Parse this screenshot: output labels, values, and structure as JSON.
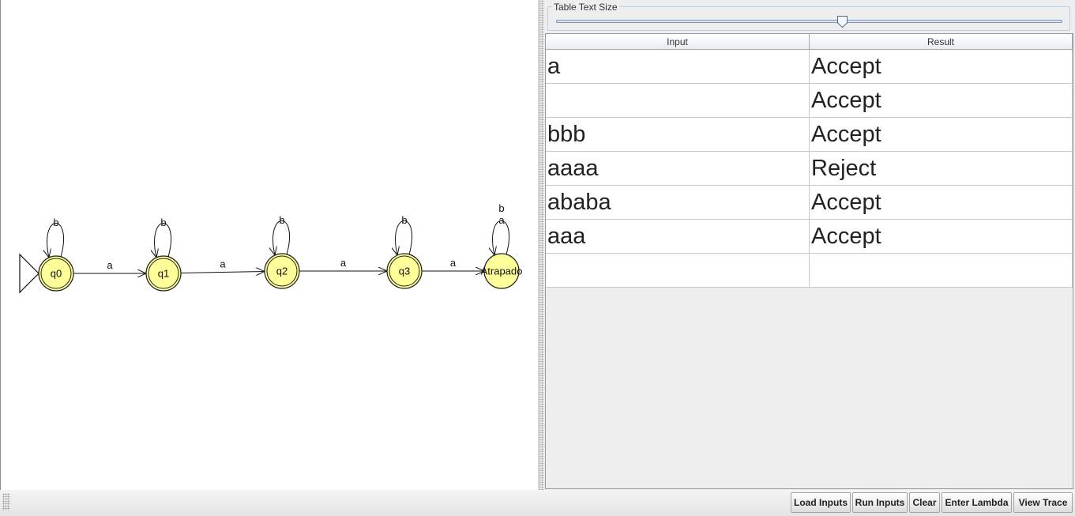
{
  "automaton": {
    "initial_state": "q0",
    "states": [
      {
        "id": "q0",
        "label": "q0",
        "final": true
      },
      {
        "id": "q1",
        "label": "q1",
        "final": true
      },
      {
        "id": "q2",
        "label": "q2",
        "final": true
      },
      {
        "id": "q3",
        "label": "q3",
        "final": true
      },
      {
        "id": "trap",
        "label": "Atrapado",
        "final": false
      }
    ],
    "transitions": [
      {
        "from": "q0",
        "to": "q0",
        "labels": [
          "b"
        ]
      },
      {
        "from": "q0",
        "to": "q1",
        "labels": [
          "a"
        ]
      },
      {
        "from": "q1",
        "to": "q1",
        "labels": [
          "b"
        ]
      },
      {
        "from": "q1",
        "to": "q2",
        "labels": [
          "a"
        ]
      },
      {
        "from": "q2",
        "to": "q2",
        "labels": [
          "b"
        ]
      },
      {
        "from": "q2",
        "to": "q3",
        "labels": [
          "a"
        ]
      },
      {
        "from": "q3",
        "to": "q3",
        "labels": [
          "b"
        ]
      },
      {
        "from": "q3",
        "to": "trap",
        "labels": [
          "a"
        ]
      },
      {
        "from": "trap",
        "to": "trap",
        "labels": [
          "b",
          "a"
        ]
      }
    ],
    "colors": {
      "state_fill": "#ffff99",
      "state_stroke": "#222222"
    }
  },
  "text_size_slider": {
    "title": "Table Text Size",
    "value_fraction": 0.565
  },
  "table": {
    "headers": {
      "input": "Input",
      "result": "Result"
    },
    "rows": [
      {
        "input": "a",
        "result": "Accept"
      },
      {
        "input": "",
        "result": "Accept"
      },
      {
        "input": "bbb",
        "result": "Accept"
      },
      {
        "input": "aaaa",
        "result": "Reject"
      },
      {
        "input": "ababa",
        "result": "Accept"
      },
      {
        "input": "aaa",
        "result": "Accept"
      },
      {
        "input": "",
        "result": ""
      }
    ]
  },
  "buttons": {
    "load_inputs": "Load Inputs",
    "run_inputs": "Run Inputs",
    "clear": "Clear",
    "enter_lambda": "Enter Lambda",
    "view_trace": "View Trace"
  }
}
